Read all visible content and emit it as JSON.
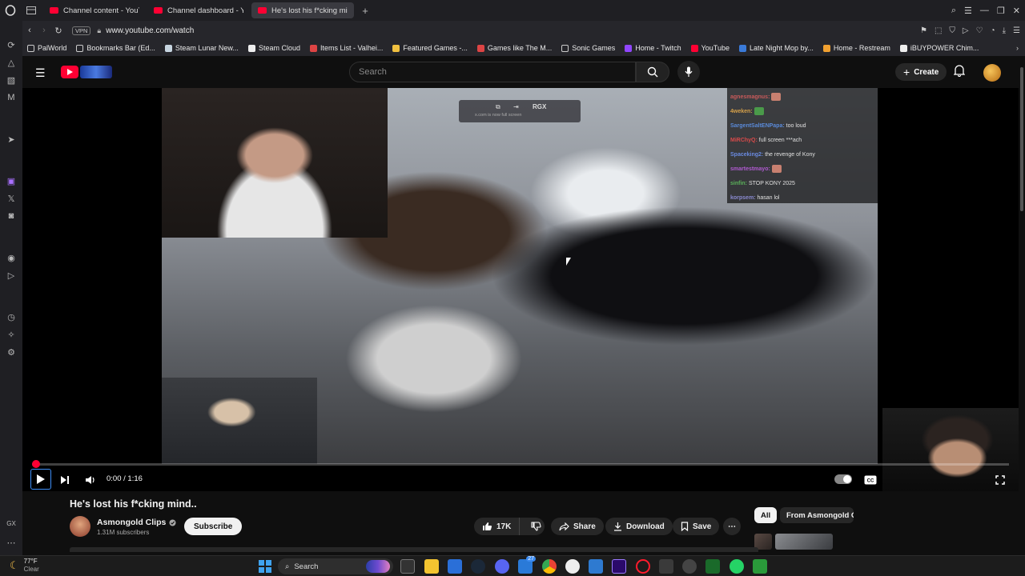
{
  "browser": {
    "tabs": [
      {
        "label": "Channel content - YouTube",
        "active": false
      },
      {
        "label": "Channel dashboard - YouTube",
        "active": false
      },
      {
        "label": "He's lost his f*cking mind..",
        "active": true
      }
    ],
    "url": "www.youtube.com/watch",
    "vpn_label": "VPN",
    "bookmarks": [
      {
        "label": "PalWorld",
        "icon": "folder-icon"
      },
      {
        "label": "Bookmarks Bar (Ed...",
        "icon": "folder-icon"
      },
      {
        "label": "Steam Lunar New...",
        "icon": "steam-icon"
      },
      {
        "label": "Steam Cloud",
        "icon": "page-icon"
      },
      {
        "label": "Items List - Valhei...",
        "icon": "gear-icon"
      },
      {
        "label": "Featured Games -...",
        "icon": "bolt-icon"
      },
      {
        "label": "Games like The M...",
        "icon": "game-icon"
      },
      {
        "label": "Sonic Games",
        "icon": "folder-icon"
      },
      {
        "label": "Home - Twitch",
        "icon": "twitch-icon"
      },
      {
        "label": "YouTube",
        "icon": "youtube-icon"
      },
      {
        "label": "Late Night Mop by...",
        "icon": "music-icon"
      },
      {
        "label": "Home - Restream",
        "icon": "restream-icon"
      },
      {
        "label": "iBUYPOWER Chim...",
        "icon": "page-icon"
      }
    ]
  },
  "youtube": {
    "search_placeholder": "Search",
    "create_label": "Create"
  },
  "player": {
    "time_display": "0:00 / 1:16",
    "progress_fraction": 0.0,
    "overlay": {
      "badge": "RGX",
      "notice": "x.com is now full screen"
    },
    "chat": [
      {
        "user": "agnesmagnus:",
        "msg": "",
        "color": "#c85a5a",
        "emote": true
      },
      {
        "user": "4weken:",
        "msg": "",
        "color": "#d4a04a",
        "emote": true
      },
      {
        "user": "SargentSaltENPapa:",
        "msg": "too loud",
        "color": "#5a8ad8",
        "emote": false
      },
      {
        "user": "MiRChyQ:",
        "msg": "full screen ***ach",
        "color": "#d84a4a",
        "emote": false
      },
      {
        "user": "Spaceking2:",
        "msg": "the revenge of Kony",
        "color": "#6a8ae0",
        "emote": false
      },
      {
        "user": "smartestmayo:",
        "msg": "",
        "color": "#b05ad0",
        "emote": true
      },
      {
        "user": "sinfin:",
        "msg": "STOP KONY 2025",
        "color": "#5ab05a",
        "emote": false
      },
      {
        "user": "korpsem:",
        "msg": "hasan lol",
        "color": "#8a8ad0",
        "emote": false
      }
    ]
  },
  "video": {
    "title": "He's lost his f*cking mind..",
    "channel": "Asmongold Clips",
    "subscribers": "1.31M subscribers",
    "subscribe_label": "Subscribe",
    "likes": "17K",
    "share_label": "Share",
    "download_label": "Download",
    "save_label": "Save"
  },
  "recommendations": {
    "chips": [
      "All",
      "From Asmongold Clips"
    ]
  },
  "taskbar": {
    "temp": "77°F",
    "condition": "Clear",
    "search_label": "Search",
    "badge_count": "27"
  },
  "colors": {
    "youtube_red": "#ff0033",
    "accent_blue": "#3e8ef7"
  }
}
